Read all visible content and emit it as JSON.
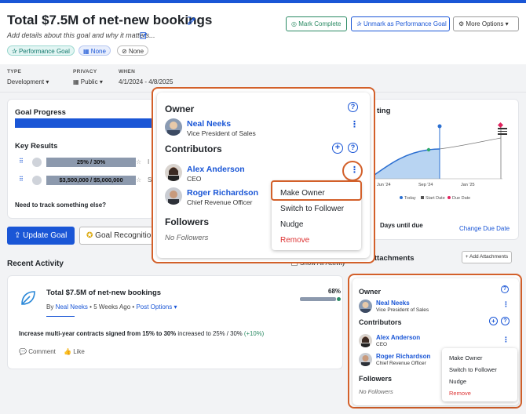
{
  "header": {
    "title": "Total $7.5M of net-new bookings",
    "subtitle": "Add details about this goal and why it matters...",
    "pill_performance": "Performance Goal",
    "pill_none_1": "None",
    "pill_none_2": "None",
    "btn_mark_complete": "Mark Complete",
    "btn_unmark": "Unmark as Performance Goal",
    "btn_more": "More Options"
  },
  "meta": {
    "type_label": "TYPE",
    "type_value": "Development",
    "privacy_label": "PRIVACY",
    "privacy_value": "Public",
    "when_label": "WHEN",
    "when_value": "4/1/2024 - 4/8/2025"
  },
  "goal_progress": {
    "title": "Goal Progress",
    "key_results_title": "Key Results",
    "kr1": "25% / 30%",
    "kr1_trunc": "I",
    "kr2": "$3,500,000 / $5,000,000",
    "kr2_trunc": "S",
    "need_track": "Need to track something else?",
    "btn_update": "Update Goal",
    "btn_recognition": "Goal Recognition"
  },
  "chart": {
    "title_trunc": "ting",
    "ticks": [
      "Jun '24",
      "Sep '24",
      "Jan '25"
    ],
    "legend_today": "Today",
    "legend_start": "Start Date",
    "legend_due": "Due Date",
    "colors": {
      "area": "#b8d4f2",
      "line": "#2b6fd1",
      "today": "#2ea86c",
      "due": "#e0245e"
    },
    "days_until_due": "Days until due",
    "change_due": "Change Due Date"
  },
  "recent_activity": {
    "title": "Recent Activity",
    "show_all": "Show All Activity",
    "item_title": "Total $7.5M of net-new bookings",
    "by": "By",
    "author": "Neal Neeks",
    "ago": "5 Weeks Ago",
    "post_options": "Post Options",
    "percent": "68%",
    "progress": 0.68,
    "change_main": "Increase multi-year contracts signed from 15% to 30%",
    "change_rest": " increased to 25% / 30% ",
    "change_delta": "(+10%)",
    "comment": "Comment",
    "like": "Like"
  },
  "attachments": {
    "title": "Attachments",
    "add": "+ Add Attachments"
  },
  "popup": {
    "owner_title": "Owner",
    "owner_name": "Neal Neeks",
    "owner_role": "Vice President of Sales",
    "contributors_title": "Contributors",
    "c1_name": "Alex Anderson",
    "c1_role": "CEO",
    "c2_name": "Roger Richardson",
    "c2_role": "Chief Revenue Officer",
    "followers_title": "Followers",
    "no_followers": "No Followers",
    "menu_make_owner": "Make Owner",
    "menu_switch": "Switch to Follower",
    "menu_nudge": "Nudge",
    "menu_remove": "Remove"
  },
  "icons": [
    "edit-icon",
    "star-person-icon",
    "grid-icon",
    "tag-icon",
    "check-circle-icon",
    "gear-icon",
    "chevron-down-icon",
    "question-icon",
    "plus-circle-icon",
    "kebab-icon",
    "leaf-icon",
    "comment-icon",
    "like-icon",
    "drag-handle-icon",
    "calendar-icon",
    "award-icon"
  ]
}
